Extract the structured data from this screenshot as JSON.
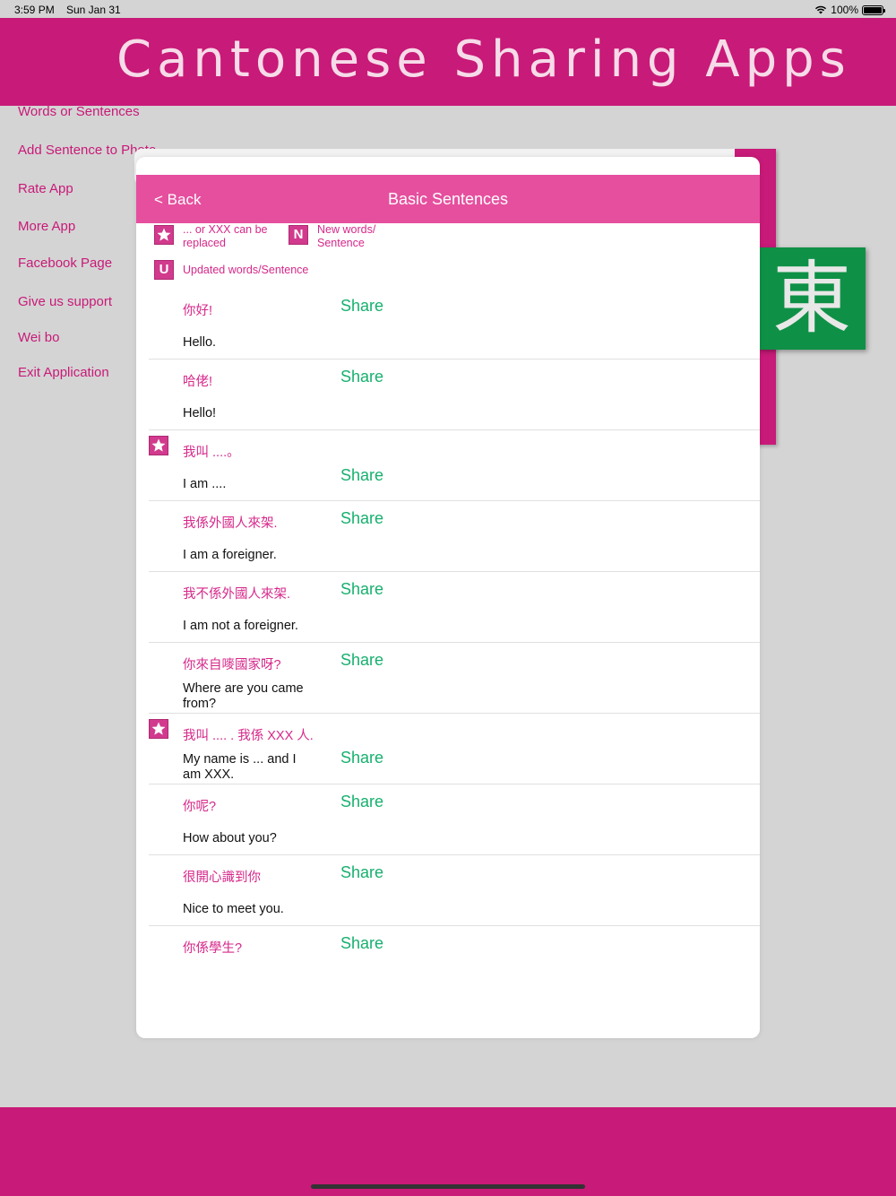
{
  "status": {
    "time": "3:59 PM",
    "date": "Sun Jan 31",
    "battery": "100%"
  },
  "banner": {
    "title": "Cantonese Sharing Apps"
  },
  "menu": [
    "Words or Sentences",
    "Add Sentence to Photo",
    "Rate App",
    "More App",
    "Facebook Page",
    "Give us support",
    "Wei bo",
    "Exit Application"
  ],
  "tile": {
    "glyph": "東"
  },
  "modal": {
    "back_label": "< Back",
    "title": "Basic Sentences",
    "legend": {
      "star_text": "... or XXX can be replaced",
      "n_letter": "N",
      "n_text": "New words/ Sentence",
      "u_letter": "U",
      "u_text": "Updated words/Sentence"
    },
    "share_label": "Share",
    "rows": [
      {
        "cn": "你好!",
        "en": "Hello.",
        "star": false
      },
      {
        "cn": "哈佬!",
        "en": "Hello!",
        "star": false
      },
      {
        "cn": "我叫 ....。",
        "en": "I am ....",
        "star": true
      },
      {
        "cn": "我係外國人來架.",
        "en": "I am a foreigner.",
        "star": false
      },
      {
        "cn": "我不係外國人來架.",
        "en": "I am not a foreigner.",
        "star": false
      },
      {
        "cn": "你來自嘜國家呀?",
        "en": "Where are you came from?",
        "star": false
      },
      {
        "cn": "我叫 .... . 我係 XXX 人.",
        "en": "My name is ... and I am XXX.",
        "star": true
      },
      {
        "cn": "你呢?",
        "en": "How about you?",
        "star": false
      },
      {
        "cn": "很開心識到你",
        "en": "Nice to meet you.",
        "star": false
      },
      {
        "cn": "你係學生?",
        "en": "",
        "star": false
      }
    ]
  },
  "colors": {
    "brand": "#c81a78",
    "navbar": "#e64f9e",
    "share": "#16b06e",
    "tile": "#0e9146"
  }
}
